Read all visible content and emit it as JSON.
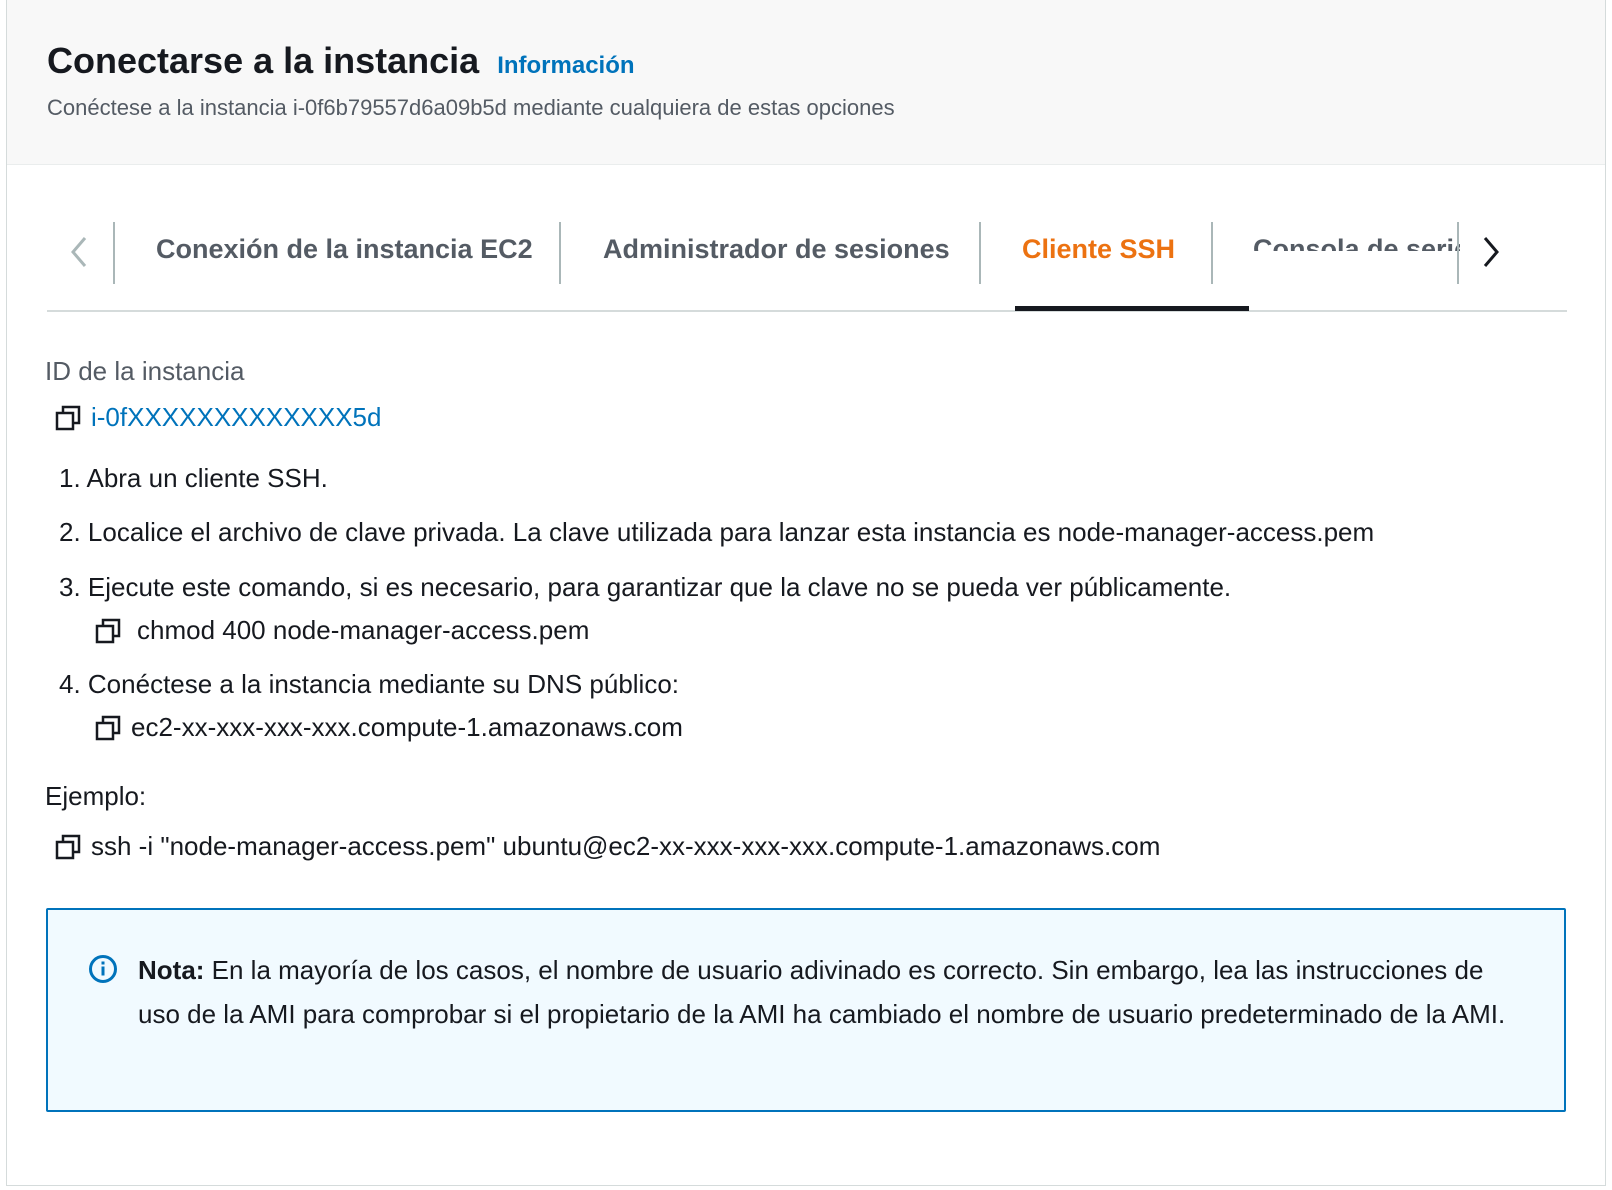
{
  "header": {
    "title": "Conectarse a la instancia",
    "info_link": "Información",
    "subtitle": "Conéctese a la instancia i-0f6b79557d6a09b5d mediante cualquiera de estas opciones"
  },
  "tabs": [
    {
      "label": "Conexión de la instancia EC2",
      "active": false
    },
    {
      "label": "Administrador de sesiones",
      "active": false
    },
    {
      "label": "Cliente SSH",
      "active": true
    },
    {
      "label": "Consola de serie",
      "active": false
    }
  ],
  "colors": {
    "active_tab": "#ec7211",
    "link": "#0073bb",
    "note_border": "#0073bb",
    "note_bg": "#f1faff"
  },
  "instance": {
    "label": "ID de la instancia",
    "id": "i-0fXXXXXXXXXXXXX5d"
  },
  "steps": {
    "s1": "1. Abra un cliente SSH.",
    "s2": "2. Localice el archivo de clave privada. La clave utilizada para lanzar esta instancia es node-manager-access.pem",
    "s3": "3. Ejecute este comando, si es necesario, para garantizar que la clave no se pueda ver públicamente.",
    "s3_command": "chmod 400 node-manager-access.pem",
    "s4": "4. Conéctese a la instancia mediante su DNS público:",
    "s4_dns": "ec2-xx-xxx-xxx-xxx.compute-1.amazonaws.com"
  },
  "example": {
    "label": "Ejemplo:",
    "command": "ssh -i \"node-manager-access.pem\" ubuntu@ec2-xx-xxx-xxx-xxx.compute-1.amazonaws.com"
  },
  "note": {
    "bold": "Nota:",
    "text": " En la mayoría de los casos, el nombre de usuario adivinado es correcto. Sin embargo, lea las instrucciones de uso de la AMI para comprobar si el propietario de la AMI ha cambiado el nombre de usuario predeterminado de la AMI."
  }
}
